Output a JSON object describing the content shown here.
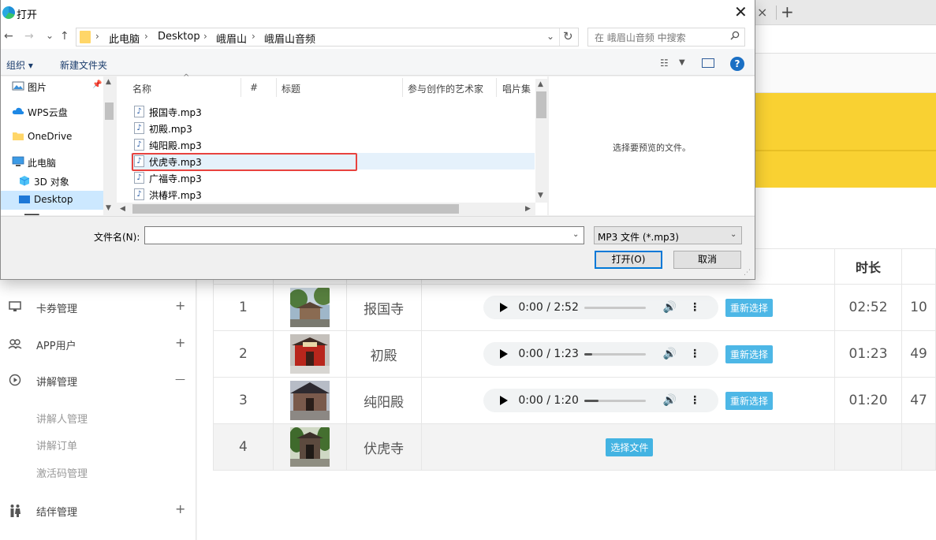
{
  "browser": {
    "tab_close": "×",
    "new_tab": "+"
  },
  "sidebar": {
    "items": [
      {
        "icon": "monitor-icon",
        "label": "卡券管理",
        "toggle": "+"
      },
      {
        "icon": "users-icon",
        "label": "APP用户",
        "toggle": "+"
      },
      {
        "icon": "play-circle-icon",
        "label": "讲解管理",
        "toggle": "—"
      },
      {
        "icon": "couple-icon",
        "label": "结伴管理",
        "toggle": "+"
      }
    ],
    "subitems": [
      "讲解人管理",
      "讲解订单",
      "激活码管理"
    ]
  },
  "table": {
    "header_duration": "时长",
    "rows": [
      {
        "index": "1",
        "name": "报国寺",
        "time": "0:00 / 2:52",
        "progress": 0,
        "button": "重新选择",
        "duration": "02:52",
        "extra": "10"
      },
      {
        "index": "2",
        "name": "初殿",
        "time": "0:00 / 1:23",
        "progress": 0.13,
        "button": "重新选择",
        "duration": "01:23",
        "extra": "49"
      },
      {
        "index": "3",
        "name": "纯阳殿",
        "time": "0:00 / 1:20",
        "progress": 0.24,
        "button": "重新选择",
        "duration": "01:20",
        "extra": "47"
      },
      {
        "index": "4",
        "name": "伏虎寺",
        "button": "选择文件"
      }
    ]
  },
  "dialog": {
    "title": "打开",
    "close": "✕",
    "nav": {
      "back": "←",
      "forward": "→",
      "recent": "⌄",
      "up": "↑"
    },
    "path": [
      "此电脑",
      "Desktop",
      "峨眉山",
      "峨眉山音频"
    ],
    "search_placeholder": "在 峨眉山音频 中搜索",
    "toolbar": {
      "organize": "组织 ▾",
      "new_folder": "新建文件夹",
      "help": "?"
    },
    "nav_pane": [
      {
        "icon": "pictures-icon",
        "label": "图片"
      },
      {
        "icon": "cloud-icon",
        "label": "WPS云盘"
      },
      {
        "icon": "folder-icon",
        "label": "OneDrive"
      },
      {
        "icon": "computer-icon",
        "label": "此电脑"
      },
      {
        "icon": "cube-icon",
        "label": "3D 对象"
      },
      {
        "icon": "desktop-icon",
        "label": "Desktop"
      }
    ],
    "columns": [
      "名称",
      "#",
      "标题",
      "参与创作的艺术家",
      "唱片集"
    ],
    "files": [
      "报国寺.mp3",
      "初殿.mp3",
      "纯阳殿.mp3",
      "伏虎寺.mp3",
      "广福寺.mp3",
      "洪椿坪.mp3"
    ],
    "selected_index": 3,
    "preview_text": "选择要预览的文件。",
    "filename_label": "文件名(N):",
    "filename_value": "",
    "filetype": "MP3 文件 (*.mp3)",
    "open_button": "打开(O)",
    "cancel_button": "取消"
  }
}
